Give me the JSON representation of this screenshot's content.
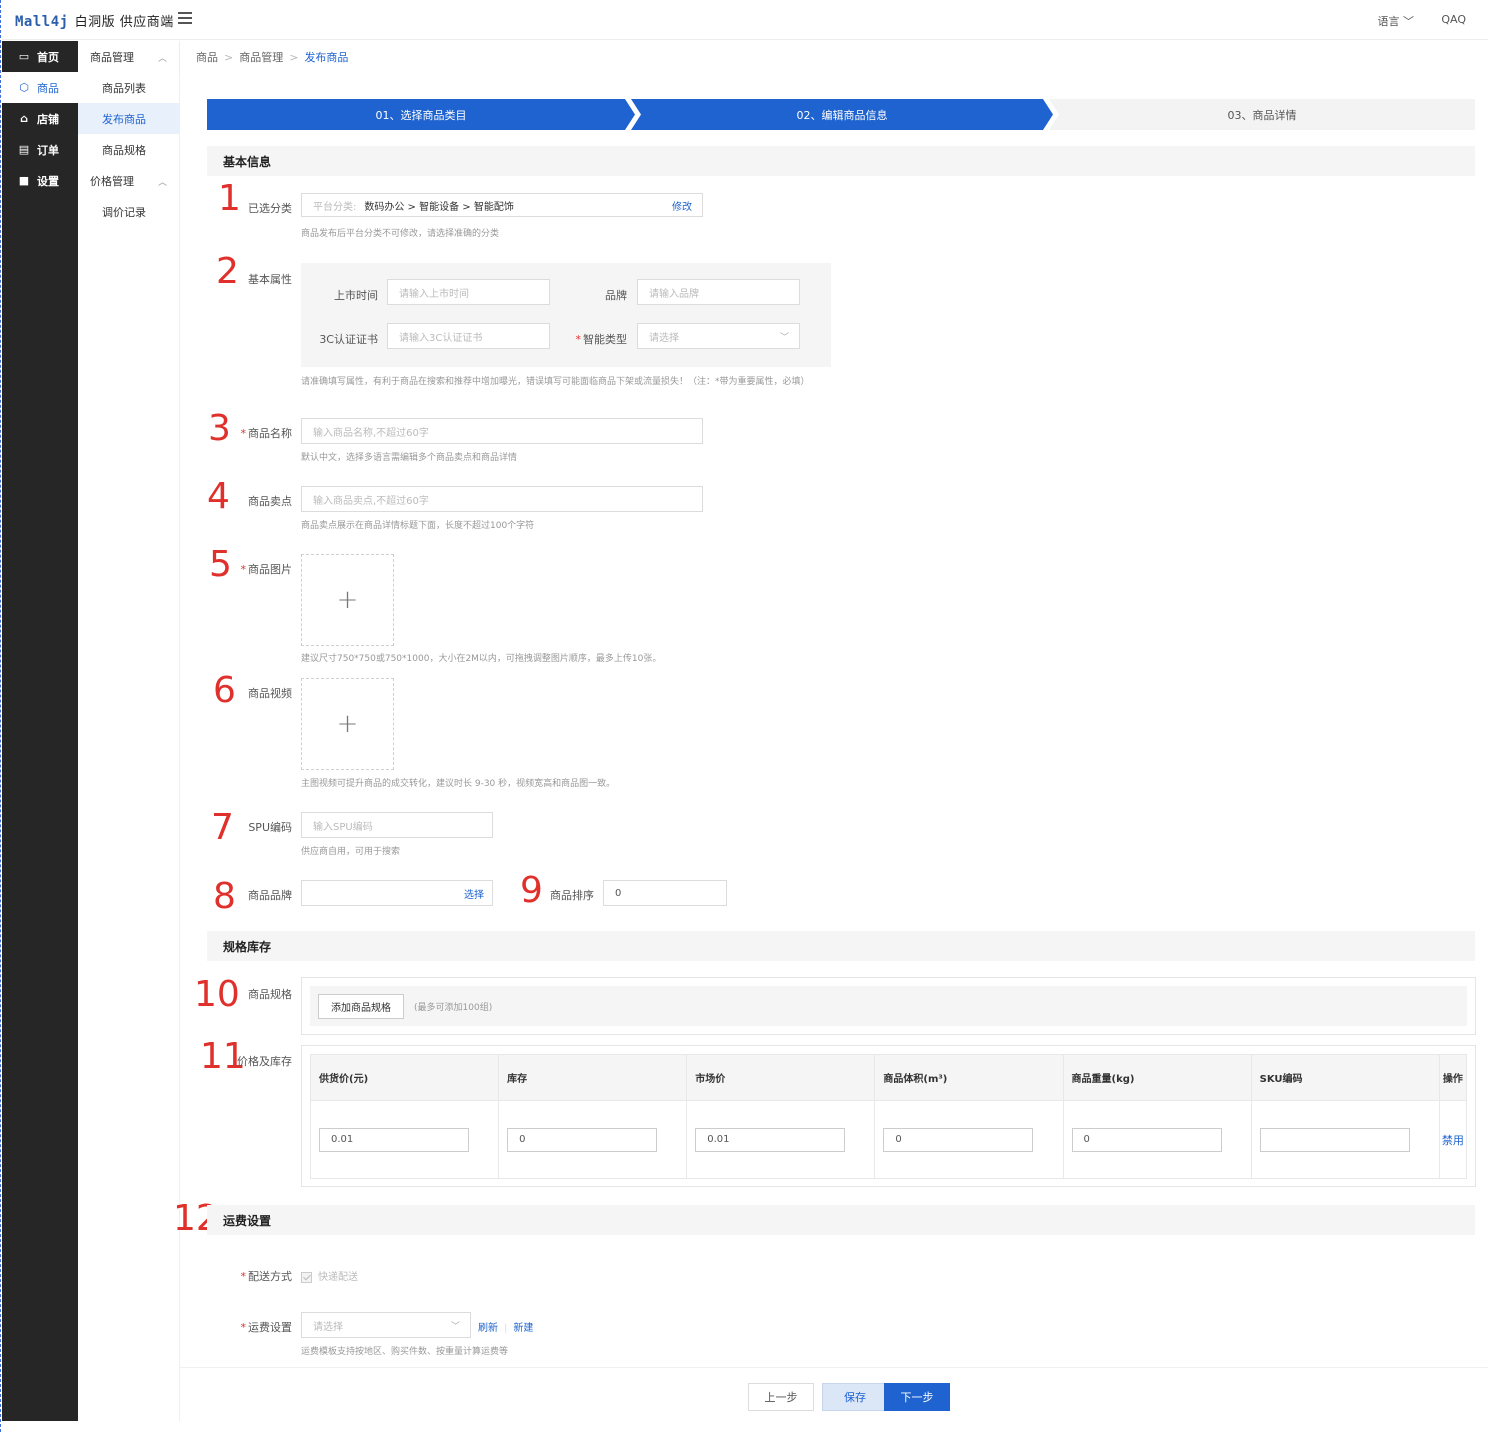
{
  "header": {
    "logo_brand": "Mall4j",
    "logo_sub": "白洞版 供应商端",
    "lang_label": "语言 ﹀",
    "user_label": "QAQ"
  },
  "rail": [
    {
      "label": "首页",
      "icon": "monitor-icon"
    },
    {
      "label": "商品",
      "icon": "cube-icon"
    },
    {
      "label": "店铺",
      "icon": "home-icon"
    },
    {
      "label": "订单",
      "icon": "document-icon"
    },
    {
      "label": "设置",
      "icon": "lock-icon"
    }
  ],
  "submenu": {
    "group1": "商品管理",
    "items1": [
      "商品列表",
      "发布商品",
      "商品规格"
    ],
    "group2": "价格管理",
    "items2": [
      "调价记录"
    ]
  },
  "breadcrumb": [
    "商品",
    "商品管理",
    "发布商品"
  ],
  "steps": [
    "01、选择商品类目",
    "02、编辑商品信息",
    "03、商品详情"
  ],
  "sections": {
    "basic": "基本信息",
    "spec": "规格库存",
    "freight": "运费设置"
  },
  "annotations": [
    "1",
    "2",
    "3",
    "4",
    "5",
    "6",
    "7",
    "8",
    "9",
    "10",
    "11",
    "12"
  ],
  "category": {
    "label": "已选分类",
    "prefix": "平台分类:",
    "value": "数码办公 > 智能设备 > 智能配饰",
    "edit": "修改",
    "help": "商品发布后平台分类不可修改，请选择准确的分类"
  },
  "attrs": {
    "label": "基本属性",
    "release_label": "上市时间",
    "release_ph": "请输入上市时间",
    "brand_label": "品牌",
    "brand_ph": "请输入品牌",
    "cert_label": "3C认证证书",
    "cert_ph": "请输入3C认证证书",
    "smart_label": "智能类型",
    "smart_ph": "请选择",
    "help": "请准确填写属性，有利于商品在搜索和推荐中增加曝光，错误填写可能面临商品下架或流量损失！（注：*带为重要属性，必填）"
  },
  "name": {
    "label": "商品名称",
    "ph": "输入商品名称,不超过60字",
    "help": "默认中文，选择多语言需编辑多个商品卖点和商品详情"
  },
  "selling": {
    "label": "商品卖点",
    "ph": "输入商品卖点,不超过60字",
    "help": "商品卖点展示在商品详情标题下面，长度不超过100个字符"
  },
  "images": {
    "label": "商品图片",
    "help": "建议尺寸750*750或750*1000，大小在2M以内，可拖拽调整图片顺序，最多上传10张。"
  },
  "video": {
    "label": "商品视频",
    "help": "主图视频可提升商品的成交转化，建议时长 9-30 秒，视频宽高和商品图一致。"
  },
  "spu": {
    "label": "SPU编码",
    "ph": "输入SPU编码",
    "help": "供应商自用，可用于搜索"
  },
  "prodbrand": {
    "label": "商品品牌",
    "select": "选择"
  },
  "sort": {
    "label": "商品排序",
    "value": "0"
  },
  "spec": {
    "label": "商品规格",
    "add": "添加商品规格",
    "hint": "(最多可添加100组)"
  },
  "price": {
    "label": "价格及库存",
    "columns": [
      "供货价(元)",
      "库存",
      "市场价",
      "商品体积(m³)",
      "商品重量(kg)",
      "SKU编码",
      "操作"
    ],
    "row": [
      "0.01",
      "0",
      "0.01",
      "0",
      "0",
      ""
    ],
    "action": "禁用"
  },
  "delivery": {
    "label": "配送方式",
    "option": "快递配送"
  },
  "freight": {
    "label": "运费设置",
    "ph": "请选择",
    "refresh": "刷新",
    "new": "新建",
    "help": "运费模板支持按地区、购买件数、按重量计算运费等"
  },
  "footer": {
    "prev": "上一步",
    "save": "保存",
    "next": "下一步"
  },
  "colors": {
    "accent": "#1e63d0",
    "annotation": "#e0302b",
    "rail": "#262626"
  }
}
